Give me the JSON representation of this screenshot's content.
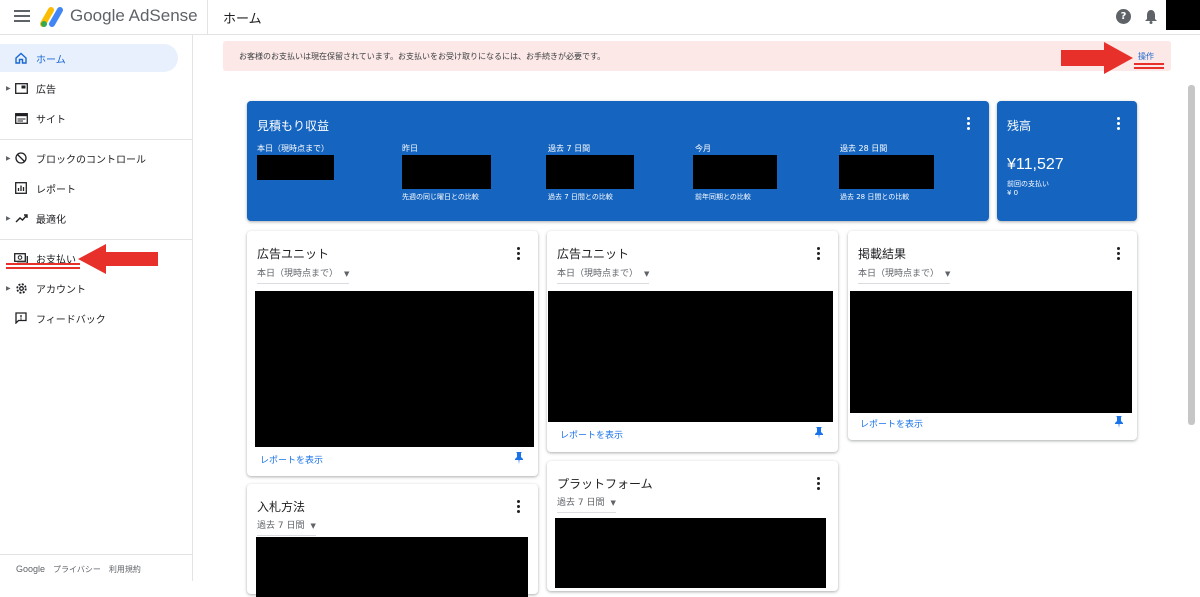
{
  "header": {
    "brand": "Google AdSense",
    "page_title": "ホーム",
    "help_icon": "?"
  },
  "sidebar": {
    "items": [
      {
        "label": "ホーム",
        "icon": "home-icon",
        "active": true
      },
      {
        "label": "広告",
        "icon": "ads-icon",
        "caret": true
      },
      {
        "label": "サイト",
        "icon": "sites-icon"
      },
      {
        "label": "ブロックのコントロール",
        "icon": "block-icon",
        "caret": true
      },
      {
        "label": "レポート",
        "icon": "reports-icon"
      },
      {
        "label": "最適化",
        "icon": "optimization-icon",
        "caret": true
      },
      {
        "label": "お支払い",
        "icon": "payments-icon"
      },
      {
        "label": "アカウント",
        "icon": "gear-icon",
        "caret": true
      },
      {
        "label": "フィードバック",
        "icon": "feedback-icon"
      }
    ],
    "footer": {
      "google": "Google",
      "privacy": "プライバシー",
      "terms": "利用規約"
    }
  },
  "banner": {
    "message": "お客様のお支払いは現在保留されています。お支払いをお受け取りになるには、お手続きが必要です。",
    "action": "操作"
  },
  "earnings": {
    "title": "見積もり収益",
    "metrics": [
      {
        "label": "本日（現時点まで）",
        "sub": ""
      },
      {
        "label": "昨日",
        "sub": "先週の同じ曜日との比較"
      },
      {
        "label": "過去 7 日間",
        "sub": "過去 7 日間との比較"
      },
      {
        "label": "今月",
        "sub": "前年同期との比較"
      },
      {
        "label": "過去 28 日間",
        "sub": "過去 28 日間との比較"
      }
    ]
  },
  "balance": {
    "title": "残高",
    "value": "¥11,527",
    "last_payment_label": "前回の支払い",
    "last_payment_value": "¥ 0"
  },
  "cards": {
    "ad_unit_1": {
      "title": "広告ユニット",
      "range": "本日（現時点まで）",
      "link": "レポートを表示"
    },
    "ad_unit_2": {
      "title": "広告ユニット",
      "range": "本日（現時点まで）",
      "link": "レポートを表示"
    },
    "placement": {
      "title": "掲載結果",
      "range": "本日（現時点まで）",
      "link": "レポートを表示"
    },
    "bidding": {
      "title": "入札方法",
      "range": "過去 7 日間"
    },
    "platform": {
      "title": "プラットフォーム",
      "range": "過去 7 日間"
    }
  },
  "colors": {
    "accent": "#1a73e8",
    "card_blue": "#1565c0",
    "banner_bg": "#fce8e6",
    "annotation_red": "#e8302a"
  }
}
